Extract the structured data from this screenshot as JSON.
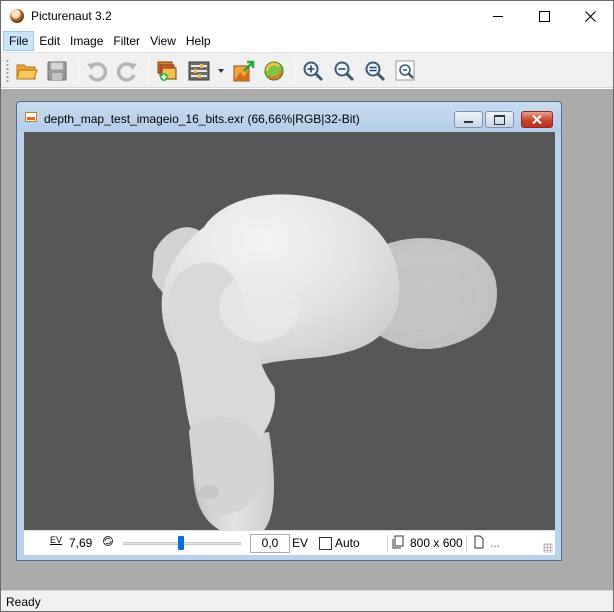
{
  "app": {
    "title": "Picturenaut 3.2"
  },
  "menu": [
    {
      "label": "File"
    },
    {
      "label": "Edit"
    },
    {
      "label": "Image"
    },
    {
      "label": "Filter"
    },
    {
      "label": "View"
    },
    {
      "label": "Help"
    }
  ],
  "toolbar": {
    "buttons": [
      {
        "icon": "open-folder-icon"
      },
      {
        "icon": "save-icon"
      },
      {
        "icon": "undo-icon"
      },
      {
        "icon": "redo-icon"
      },
      {
        "icon": "generate-hdr-icon"
      },
      {
        "icon": "adjust-settings-icon"
      },
      {
        "icon": "tone-map-icon"
      },
      {
        "icon": "batch-process-icon"
      },
      {
        "icon": "zoom-in-icon"
      },
      {
        "icon": "zoom-out-icon"
      },
      {
        "icon": "zoom-fit-icon"
      },
      {
        "icon": "zoom-actual-icon"
      }
    ]
  },
  "document": {
    "title": "depth_map_test_imageio_16_bits.exr (66,66%|RGB|32-Bit)",
    "status": {
      "ev_label": "EV",
      "ev_value": "7,69",
      "exposure_value": "0,0",
      "exposure_unit": "EV",
      "auto_label": "Auto",
      "auto_checked": false,
      "dimensions": "800 x 600",
      "more": "..."
    }
  },
  "statusbar": {
    "text": "Ready"
  },
  "colors": {
    "workspace": "#ababab",
    "canvas": "#575757",
    "child_frame": "#b9d1ea",
    "menu_highlight": "#cce4f7",
    "close_button": "#c7422f"
  }
}
